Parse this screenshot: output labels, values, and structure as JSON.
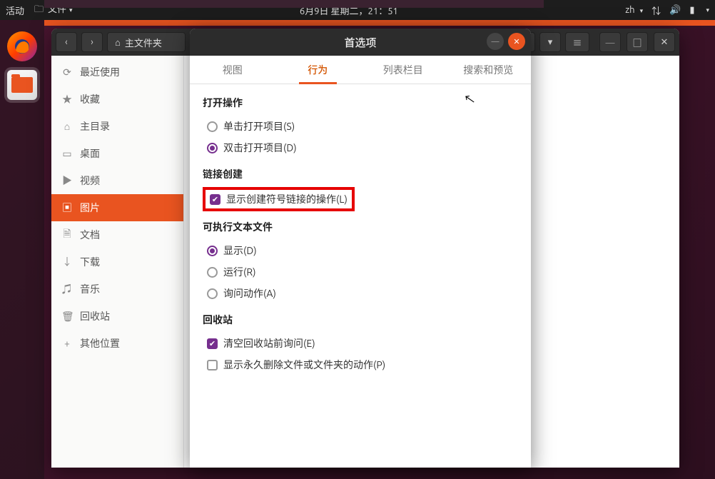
{
  "panel": {
    "activities": "活动",
    "app_name": "文件",
    "datetime": "6月9日 星期二，21：51",
    "input_method": "zh"
  },
  "fm": {
    "path_label": "主文件夹",
    "sidebar": [
      {
        "icon": "⟳",
        "label": "最近使用"
      },
      {
        "icon": "★",
        "label": "收藏"
      },
      {
        "icon": "⌂",
        "label": "主目录"
      },
      {
        "icon": "▭",
        "label": "桌面"
      },
      {
        "icon": "▶",
        "label": "视频"
      },
      {
        "icon": "▣",
        "label": "图片"
      },
      {
        "icon": "🗎",
        "label": "文档"
      },
      {
        "icon": "↓",
        "label": "下载"
      },
      {
        "icon": "♫",
        "label": "音乐"
      },
      {
        "icon": "🗑",
        "label": "回收站"
      },
      {
        "icon": "+",
        "label": "其他位置"
      }
    ],
    "active_index": 5
  },
  "pref": {
    "title": "首选项",
    "tabs": [
      "视图",
      "行为",
      "列表栏目",
      "搜索和预览"
    ],
    "active_tab": 1,
    "sections": {
      "open": {
        "title": "打开操作",
        "opts": [
          "单击打开项目(S)",
          "双击打开项目(D)"
        ],
        "selected": 1
      },
      "link": {
        "title": "链接创建",
        "opts": [
          "显示创建符号链接的操作(L)"
        ],
        "checked": [
          true
        ]
      },
      "exec": {
        "title": "可执行文本文件",
        "opts": [
          "显示(D)",
          "运行(R)",
          "询问动作(A)"
        ],
        "selected": 0
      },
      "trash": {
        "title": "回收站",
        "opts": [
          "清空回收站前询问(E)",
          "显示永久删除文件或文件夹的动作(P)"
        ],
        "checked": [
          true,
          false
        ]
      }
    }
  }
}
